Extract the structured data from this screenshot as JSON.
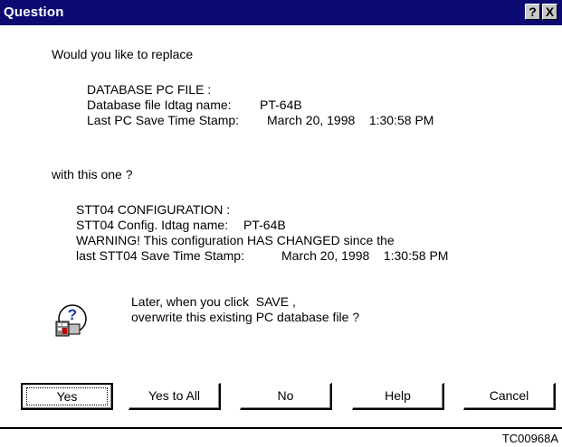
{
  "dialog": {
    "title": "Question",
    "help_glyph": "?",
    "close_glyph": "X"
  },
  "body": {
    "intro": "Would you like to replace",
    "db_header": "DATABASE PC FILE :",
    "db_idtag_label": "Database file Idtag name:",
    "db_idtag_value": "PT-64B",
    "db_timestamp_label": "Last PC Save Time Stamp:",
    "db_timestamp_value": "March 20, 1998    1:30:58 PM",
    "with_text": "with this one ?",
    "stt_header": "STT04 CONFIGURATION :",
    "stt_idtag_label": "STT04 Config. Idtag name:",
    "stt_idtag_value": "PT-64B",
    "stt_warning": "WARNING! This configuration HAS CHANGED since the",
    "stt_timestamp_label": "last STT04 Save Time Stamp:",
    "stt_timestamp_value": "March 20, 1998    1:30:58 PM",
    "prompt_line1": "Later, when you click  SAVE ,",
    "prompt_line2": "overwrite this existing PC database file ?",
    "icon": "question-icon"
  },
  "buttons": {
    "yes": "Yes",
    "yes_to_all": "Yes to All",
    "no": "No",
    "help": "Help",
    "cancel": "Cancel"
  },
  "figure_code": "TC00968A"
}
